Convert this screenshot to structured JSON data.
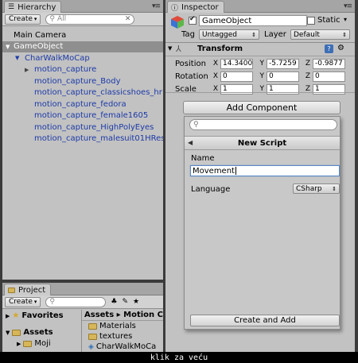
{
  "hierarchy": {
    "tab": "Hierarchy",
    "create_label": "Create",
    "search_placeholder": "All",
    "items": [
      {
        "label": "Main Camera"
      },
      {
        "label": "GameObject"
      },
      {
        "label": "CharWalkMoCap"
      },
      {
        "label": "motion_capture"
      },
      {
        "label": "motion_capture_Body"
      },
      {
        "label": "motion_capture_classicshoes_hr"
      },
      {
        "label": "motion_capture_fedora"
      },
      {
        "label": "motion_capture_female1605"
      },
      {
        "label": "motion_capture_HighPolyEyes"
      },
      {
        "label": "motion_capture_malesuit01HRes"
      }
    ]
  },
  "inspector": {
    "tab": "Inspector",
    "object_name": "GameObject",
    "static_label": "Static",
    "tag_label": "Tag",
    "tag_value": "Untagged",
    "layer_label": "Layer",
    "layer_value": "Default",
    "transform": {
      "title": "Transform",
      "rows": [
        {
          "label": "Position",
          "x": "14.3400",
          "y": "-5.7259",
          "z": "-0.9877"
        },
        {
          "label": "Rotation",
          "x": "0",
          "y": "0",
          "z": "0"
        },
        {
          "label": "Scale",
          "x": "1",
          "y": "1",
          "z": "1"
        }
      ],
      "axes": {
        "x": "X",
        "y": "Y",
        "z": "Z"
      }
    },
    "add_component": "Add Component",
    "popup": {
      "title": "New Script",
      "name_label": "Name",
      "name_value": "Movement",
      "language_label": "Language",
      "language_value": "CSharp",
      "create_button": "Create and Add"
    }
  },
  "project": {
    "tab": "Project",
    "create_label": "Create",
    "favorites": "Favorites",
    "assets": "Assets",
    "moji": "Moji",
    "breadcrumb": "Assets ▸ Motion Ca",
    "folders": [
      "Materials",
      "textures",
      "CharWalkMoCa"
    ]
  },
  "caption": "klik za veću"
}
